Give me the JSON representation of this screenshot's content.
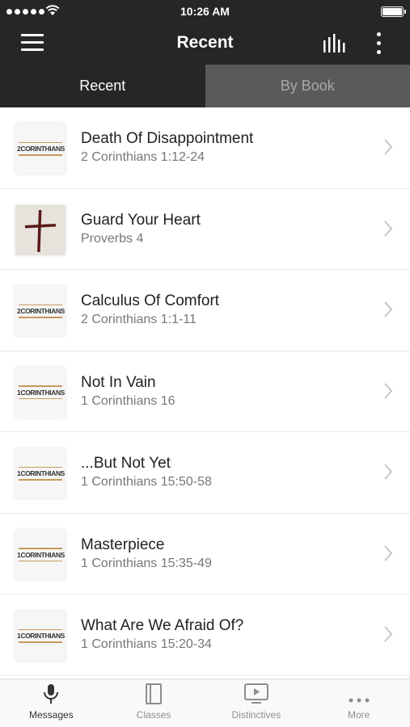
{
  "status_bar": {
    "time": "10:26 AM"
  },
  "nav": {
    "title": "Recent",
    "menu_icon": "hamburger-menu-icon",
    "audio_icon": "audio-bars-icon",
    "more_icon": "vertical-dots-icon"
  },
  "tabs": [
    {
      "label": "Recent",
      "active": true
    },
    {
      "label": "By Book",
      "active": false
    }
  ],
  "messages": [
    {
      "title": "Death Of Disappointment",
      "reference": "2 Corinthians 1:12-24",
      "thumb": "2CORINTHIANS"
    },
    {
      "title": "Guard Your Heart",
      "reference": "Proverbs 4",
      "thumb": "cross-image"
    },
    {
      "title": "Calculus Of Comfort",
      "reference": "2 Corinthians 1:1-11",
      "thumb": "2CORINTHIANS"
    },
    {
      "title": "Not In Vain",
      "reference": "1 Corinthians 16",
      "thumb": "1CORINTHIANS"
    },
    {
      "title": "...But Not Yet",
      "reference": "1 Corinthians 15:50-58",
      "thumb": "1CORINTHIANS"
    },
    {
      "title": "Masterpiece",
      "reference": "1 Corinthians 15:35-49",
      "thumb": "1CORINTHIANS"
    },
    {
      "title": "What Are We Afraid Of?",
      "reference": "1 Corinthians 15:20-34",
      "thumb": "1CORINTHIANS"
    }
  ],
  "tab_bar": [
    {
      "label": "Messages",
      "icon": "microphone-icon",
      "active": true
    },
    {
      "label": "Classes",
      "icon": "book-icon",
      "active": false
    },
    {
      "label": "Distinctives",
      "icon": "tv-play-icon",
      "active": false
    },
    {
      "label": "More",
      "icon": "more-dots-icon",
      "active": false
    }
  ],
  "colors": {
    "header_bg": "#262626",
    "inactive_tab_bg": "#5a5a5a",
    "inactive_tab_text": "#a8a8a8",
    "accent_line": "#c79a5b",
    "cross_color": "#5a1a1a"
  }
}
